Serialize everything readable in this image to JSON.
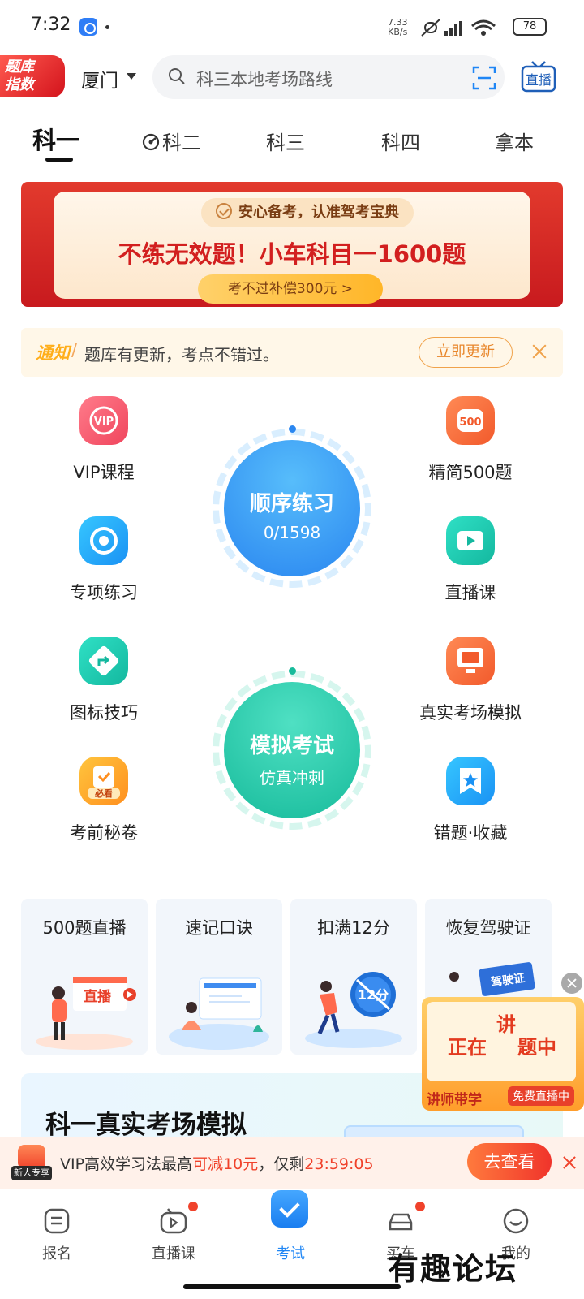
{
  "status_bar": {
    "time": "7:32",
    "net_speed_value": "7.33",
    "net_speed_unit": "KB/s",
    "battery": "78"
  },
  "header": {
    "logo_line1": "题库",
    "logo_line2": "指数",
    "city": "厦门",
    "search_placeholder": "科三本地考场路线",
    "live_label": "直播"
  },
  "tabs": [
    {
      "label": "科一",
      "active": true
    },
    {
      "label": "科二",
      "active": false
    },
    {
      "label": "科三",
      "active": false
    },
    {
      "label": "科四",
      "active": false
    },
    {
      "label": "拿本",
      "active": false
    }
  ],
  "banner": {
    "top_text": "安心备考，认准驾考宝典",
    "main_text": "不练无效题！小车科目一1600题",
    "pill_text": "考不过补偿300元 >"
  },
  "notice": {
    "tag": "通知",
    "slash": "/",
    "text": "题库有更新，考点不错过。",
    "button": "立即更新"
  },
  "features": [
    {
      "label": "VIP课程",
      "icon": "vip-icon"
    },
    {
      "label": "精简500题",
      "icon": "500-icon"
    },
    {
      "label": "专项练习",
      "icon": "target-icon"
    },
    {
      "label": "直播课",
      "icon": "video-icon"
    },
    {
      "label": "图标技巧",
      "icon": "road-sign-icon"
    },
    {
      "label": "真实考场模拟",
      "icon": "monitor-icon"
    },
    {
      "label": "考前秘卷",
      "icon": "paper-icon",
      "badge": "必看"
    },
    {
      "label": "错题·收藏",
      "icon": "star-bookmark-icon"
    }
  ],
  "practice": {
    "title": "顺序练习",
    "progress": "0/1598"
  },
  "mock_exam": {
    "title": "模拟考试",
    "subtitle": "仿真冲刺"
  },
  "topics": [
    {
      "title": "500题直播",
      "art_label": "直播"
    },
    {
      "title": "速记口诀"
    },
    {
      "title": "扣满12分",
      "art_label": "12分"
    },
    {
      "title": "恢复驾驶证",
      "art_label": "驾驶证"
    }
  ],
  "float_promo": {
    "line_a": "正在",
    "line_b": "讲",
    "line_c": "题中",
    "bottom_left": "讲师带学",
    "bottom_right": "免费直播中"
  },
  "section": {
    "title": "科一真实考场模拟"
  },
  "vip_strip": {
    "gift_tag": "新人专享",
    "text_before": "VIP高效学习法最高",
    "text_highlight": "可减10元",
    "text_middle": "，仅剩",
    "countdown": "23:59:05",
    "button": "去查看"
  },
  "bottom_nav": [
    {
      "label": "报名",
      "icon": "form-icon"
    },
    {
      "label": "直播课",
      "icon": "tv-icon",
      "badge": true
    },
    {
      "label": "考试",
      "icon": "exam-icon",
      "active": true
    },
    {
      "label": "买车",
      "icon": "car-icon",
      "badge": true
    },
    {
      "label": "我的",
      "icon": "smile-icon"
    }
  ],
  "watermark": "有趣论坛",
  "colors": {
    "accent_blue": "#1f86f5",
    "accent_green": "#17bb9b",
    "brand_red": "#d3131c",
    "notice_orange": "#ffae1a"
  }
}
